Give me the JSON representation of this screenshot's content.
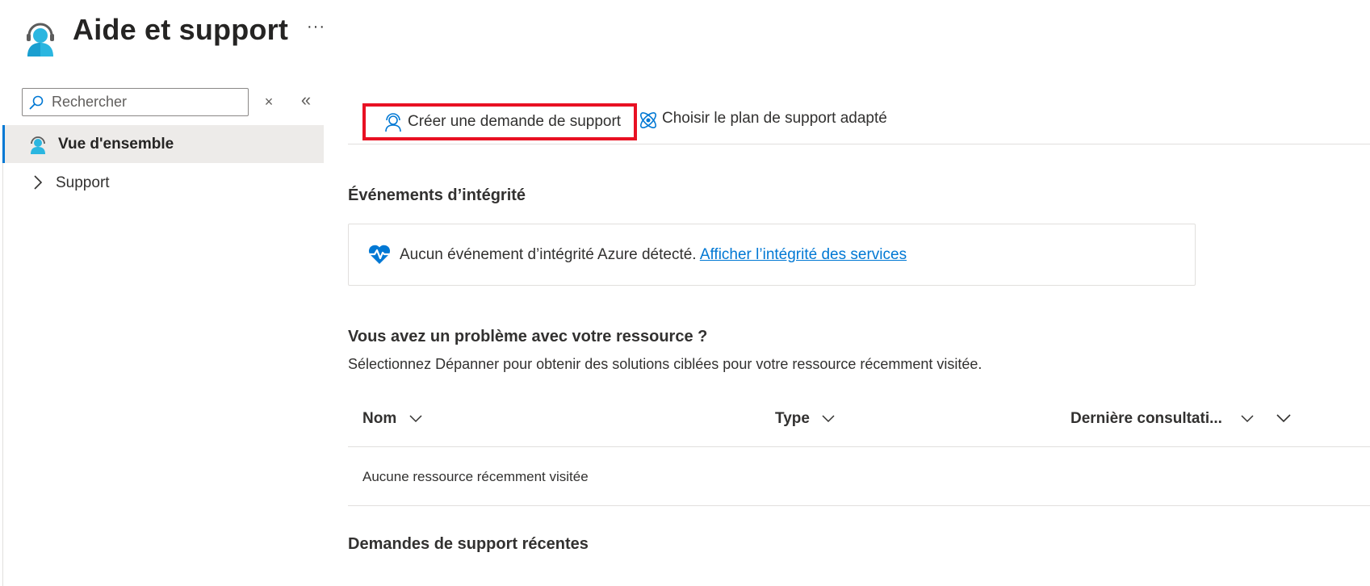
{
  "header": {
    "title": "Aide et support",
    "more_label": "···"
  },
  "sidebar": {
    "search_placeholder": "Rechercher",
    "clear_label": "×",
    "collapse_label": "«",
    "items": [
      {
        "label": "Vue d'ensemble",
        "selected": true
      },
      {
        "label": "Support",
        "selected": false
      }
    ]
  },
  "toolbar": {
    "create_label": "Créer une demande de support",
    "plan_label": "Choisir le plan de support adapté"
  },
  "health": {
    "title": "Événements d’intégrité",
    "message": "Aucun événement d’intégrité Azure détecté.",
    "link": "Afficher l’intégrité des services"
  },
  "resources": {
    "title": "Vous avez un problème avec votre ressource ?",
    "subtitle": "Sélectionnez Dépanner pour obtenir des solutions ciblées pour votre ressource récemment visitée.",
    "columns": [
      "Nom",
      "Type",
      "Dernière consultati..."
    ],
    "empty_text": "Aucune ressource récemment visitée"
  },
  "recent": {
    "title": "Demandes de support récentes"
  },
  "colors": {
    "accent": "#0078d4",
    "highlight": "#e81123",
    "selected_bg": "#edebe9"
  }
}
